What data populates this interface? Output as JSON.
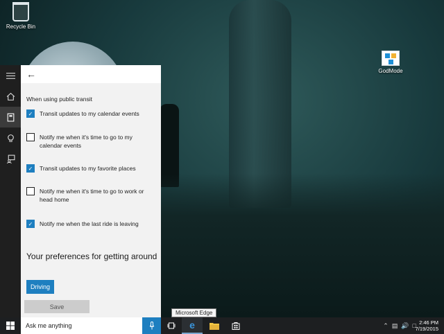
{
  "desktop": {
    "recycle_bin_label": "Recycle Bin",
    "godmode_label": "GodMode"
  },
  "cortana": {
    "section_label": "When using public transit",
    "options": [
      {
        "label": "Transit updates to my calendar events",
        "checked": true
      },
      {
        "label": "Notify me when it's time to go to my calendar events",
        "checked": false
      },
      {
        "label": "Transit updates to my favorite places",
        "checked": true
      },
      {
        "label": "Notify me when it's time to go to work or head home",
        "checked": false
      },
      {
        "label": "Notify me when the last ride is leaving",
        "checked": true
      }
    ],
    "preferences_heading": "Your preferences for getting around",
    "driving_button": "Driving",
    "save_button": "Save"
  },
  "taskbar": {
    "search_placeholder": "Ask me anything",
    "tooltip": "Microsoft Edge",
    "time": "2:46 PM",
    "date": "7/19/2015"
  },
  "colors": {
    "accent": "#1e7fc0",
    "panel_bg": "#f2f2f2",
    "rail_bg": "#1f1f1f",
    "taskbar_bg": "#1d1f21"
  }
}
